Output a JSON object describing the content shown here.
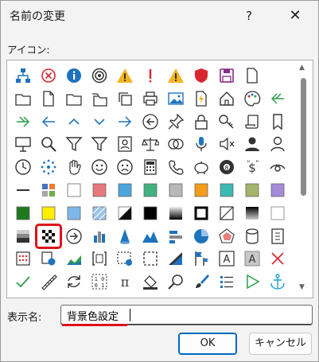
{
  "dialog": {
    "title": "名前の変更",
    "help_glyph": "?",
    "close_glyph": "✕"
  },
  "icons_section": {
    "label": "アイコン:"
  },
  "icons": [
    [
      "hierarchy-icon",
      "error-circle-icon",
      "info-icon",
      "target-icon",
      "warning-icon",
      "exclamation-icon",
      "warning-icon",
      "shield-icon",
      "save-icon",
      "page-icon"
    ],
    [
      "folder-icon",
      "document-icon",
      "folder-icon",
      "folders-icon",
      "copy-icon",
      "print-icon",
      "image-icon",
      "document-flash-icon",
      "home-icon",
      "palette-icon",
      "double-left-arrow-icon"
    ],
    [
      "double-right-arrow-icon",
      "left-arrow-icon",
      "up-chevron-icon",
      "down-chevron-icon",
      "right-arrow-icon",
      "back-circle-icon",
      "pin-icon",
      "lock-icon",
      "key-icon",
      "scroll-icon",
      "bookmark-icon"
    ],
    [
      "presentation-icon",
      "magnifier-icon",
      "funnel-icon",
      "funnel-icon",
      "contact-card-icon",
      "scales-icon",
      "circles-icon",
      "microphone-icon",
      "mute-icon",
      "person-icon",
      "person-outline-icon"
    ],
    [
      "clock-icon",
      "dots-circle-icon",
      "hand-icon",
      "smile-icon",
      "frown-icon",
      "calculator-icon",
      "phone-icon",
      "piggy-bank-icon",
      "eight-ball-icon",
      "dollar-quote-icon",
      "eye-icon"
    ],
    [
      "minus-icon",
      "color-grid-icon",
      "swatch-white-icon",
      "swatch-pink-icon",
      "swatch-blue-icon",
      "swatch-green-icon",
      "swatch-gray-icon",
      "swatch-orange-icon",
      "swatch-teal-icon",
      "swatch-olive-icon",
      "swatch-lavender-icon"
    ],
    [
      "swatch-darkgreen-icon",
      "swatch-yellow-icon",
      "swatch-lightblue-icon",
      "swatch-pattern-icon",
      "swatch-half-icon",
      "swatch-black-icon",
      "swatch-gradient-icon",
      "frame-square-icon",
      "diagonal-square-icon",
      "swatch-gradient2-icon",
      "swatch-empty-icon"
    ],
    [
      "swatch-bands-icon",
      "checker-icon",
      "arrow-circle-icon",
      "bar-chart-icon",
      "cone-icon",
      "mountains-icon",
      "bar-horizontal-icon",
      "pie-chart-icon",
      "radar-chart-icon",
      "database-icon",
      "notebook-icon"
    ],
    [
      "table-dots-icon",
      "object-icon",
      "area-chart-icon",
      "bracket-table-icon",
      "image-dashed-icon",
      "dashed-frame-icon",
      "triangles-icon",
      "flags-icon",
      "text-a-icon",
      "text-a-gray-icon",
      "delete-x-icon"
    ],
    [
      "check-icon",
      "ruler-icon",
      "refresh-icon",
      "binary-icon",
      "pi-icon",
      "paint-bucket-icon",
      "search-lens-icon",
      "paintbrush-icon",
      "list-icon",
      "play-icon",
      "anchor-icon"
    ]
  ],
  "colors": {
    "accent": "#0067c0",
    "highlight": "#e0101a",
    "icon_blue": "#1e73be",
    "icon_green": "#2e9e4a"
  },
  "display_name": {
    "label": "表示名:",
    "value": "背景色設定"
  },
  "buttons": {
    "ok": "OK",
    "cancel": "キャンセル"
  }
}
